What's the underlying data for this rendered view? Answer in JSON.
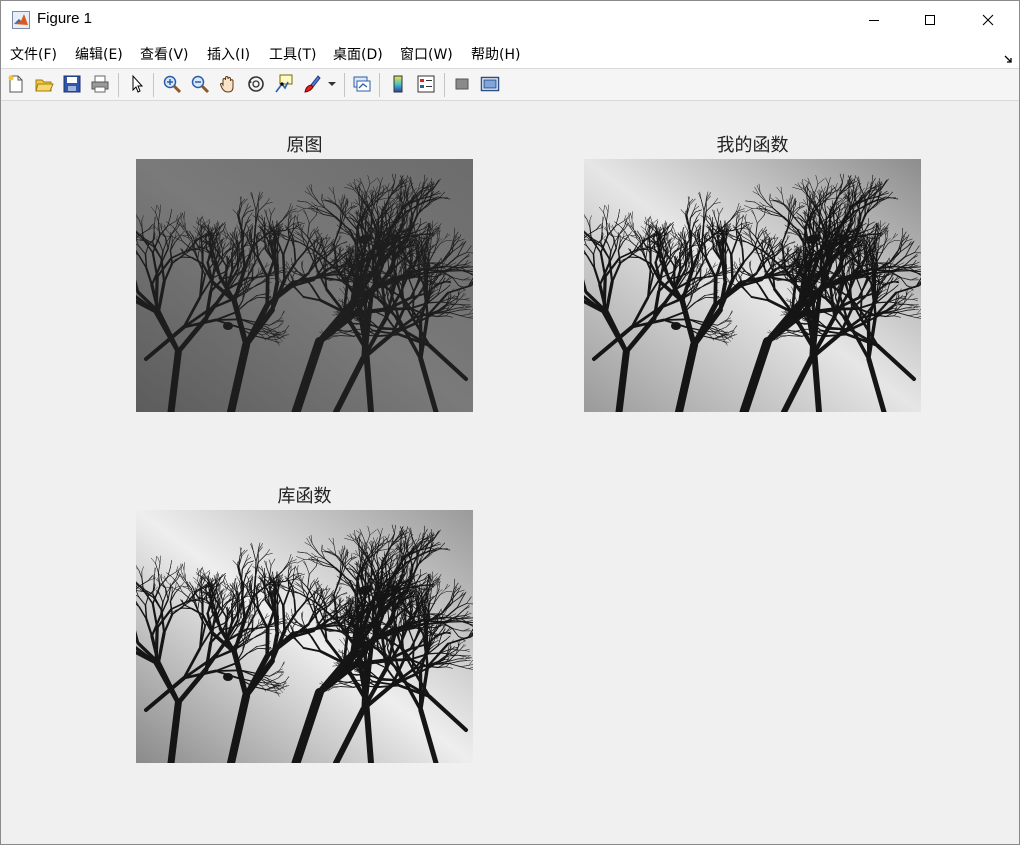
{
  "window": {
    "title": "Figure 1",
    "controls": {
      "minimize": "minimize",
      "maximize": "maximize",
      "close": "close"
    }
  },
  "menubar": {
    "items": [
      {
        "label": "文件(F)"
      },
      {
        "label": "编辑(E)"
      },
      {
        "label": "查看(V)"
      },
      {
        "label": "插入(I)"
      },
      {
        "label": "工具(T)"
      },
      {
        "label": "桌面(D)"
      },
      {
        "label": "窗口(W)"
      },
      {
        "label": "帮助(H)"
      }
    ]
  },
  "toolbar": {
    "icons": [
      "new-figure-icon",
      "open-file-icon",
      "save-icon",
      "print-icon",
      "select-pointer-icon",
      "zoom-in-icon",
      "zoom-out-icon",
      "pan-hand-icon",
      "rotate-3d-icon",
      "data-cursor-icon",
      "brush-icon",
      "link-plot-icon",
      "colorbar-icon",
      "legend-icon",
      "hide-plot-tools-icon",
      "show-plot-tools-icon"
    ]
  },
  "figure": {
    "subplots": [
      {
        "title": "原图",
        "tone": "original"
      },
      {
        "title": "我的函数",
        "tone": "enhanced"
      },
      {
        "title": "库函数",
        "tone": "library"
      }
    ]
  },
  "colors": {
    "title_text": "#222222",
    "canvas_bg": "#f0f0f0",
    "branch": "#151515"
  }
}
